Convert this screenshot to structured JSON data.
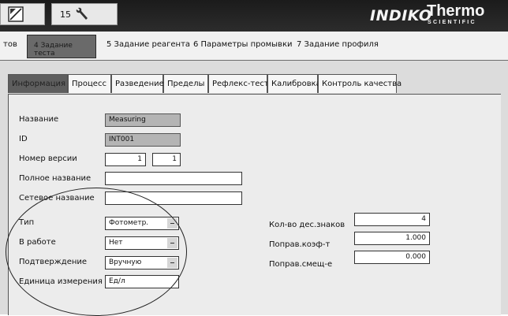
{
  "header": {
    "number_label": "15",
    "brand_indiko": "INDIKO",
    "brand_thermo": "Thermo",
    "brand_scientific": "SCIENTIFIC"
  },
  "main_tabs": {
    "partial_label": "тов",
    "active_label": "4 Задание теста",
    "tab5": "5 Задание реагента",
    "tab6": "6 Параметры промывки",
    "tab7": "7 Задание профиля"
  },
  "sub_tabs": [
    "Информация",
    "Процесс",
    "Разведение",
    "Пределы",
    "Рефлекс-тест",
    "Калибровка",
    "Контроль качества"
  ],
  "form": {
    "name_label": "Название",
    "name_value": "Measuring",
    "id_label": "ID",
    "id_value": "INT001",
    "version_label": "Номер версии",
    "version_major": "1",
    "version_minor": "1",
    "fullname_label": "Полное название",
    "fullname_value": "",
    "netname_label": "Сетевое название",
    "netname_value": "",
    "type_label": "Тип",
    "type_value": "Фотометр.",
    "inwork_label": "В работе",
    "inwork_value": "Нет",
    "confirm_label": "Подтверждение",
    "confirm_value": "Вручную",
    "unit_label": "Единица измерения",
    "unit_value": "Ед/л",
    "decimals_label": "Кол-во дес.знаков",
    "decimals_value": "4",
    "factor_label": "Поправ.коэф-т",
    "factor_value": "1.000",
    "offset_label": "Поправ.смещ-е",
    "offset_value": "0.000"
  }
}
